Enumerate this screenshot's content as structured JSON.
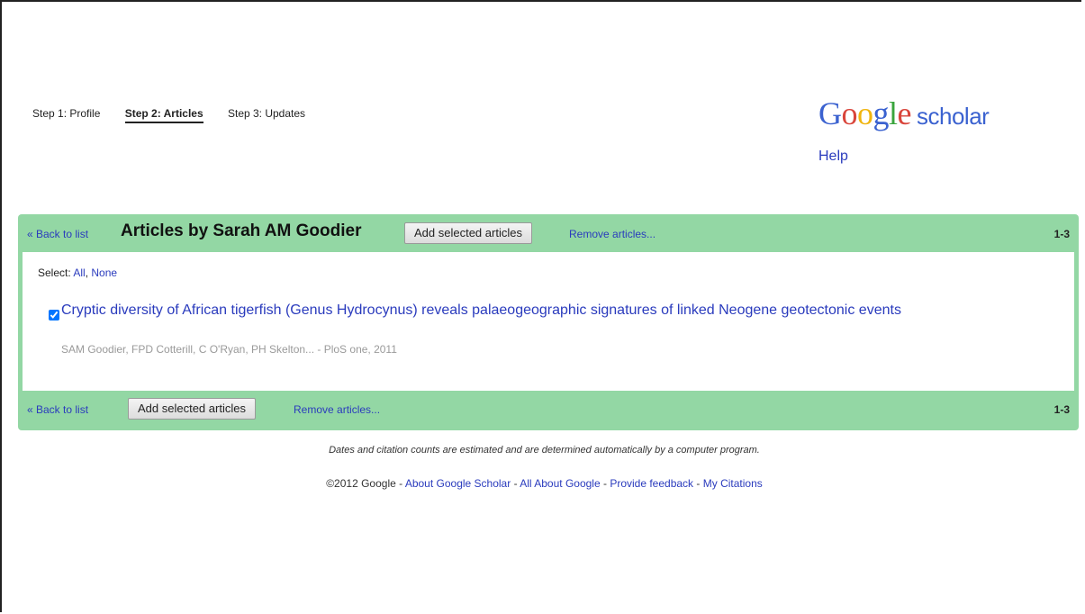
{
  "steps": [
    "Step 1: Profile",
    "Step 2: Articles",
    "Step 3: Updates"
  ],
  "logo": {
    "google": "Google",
    "scholar": "scholar"
  },
  "help": "Help",
  "header": {
    "back": "« Back to list",
    "title": "Articles by Sarah AM Goodier",
    "add_button": "Add selected articles",
    "remove": "Remove articles...",
    "range": "1-3"
  },
  "select": {
    "label": "Select:",
    "all": "All",
    "separator": ",",
    "none": "None"
  },
  "article": {
    "title": "Cryptic diversity of African tigerfish (Genus Hydrocynus) reveals palaeogeographic signatures of linked Neogene geotectonic events",
    "meta": "SAM Goodier, FPD Cotterill, C O'Ryan, PH Skelton... - PloS one, 2011",
    "checked": true
  },
  "footer_bar": {
    "back": "« Back to list",
    "add_button": "Add selected articles",
    "remove": "Remove articles...",
    "range": "1-3"
  },
  "note": "Dates and citation counts are estimated and are determined automatically by a computer program.",
  "footer": {
    "copyright": "©2012 Google",
    "sep": " - ",
    "links": [
      "About Google Scholar",
      "All About Google",
      "Provide feedback",
      "My Citations"
    ]
  },
  "colors": {
    "panel": "#93d7a4",
    "link": "#2a3bbd"
  }
}
